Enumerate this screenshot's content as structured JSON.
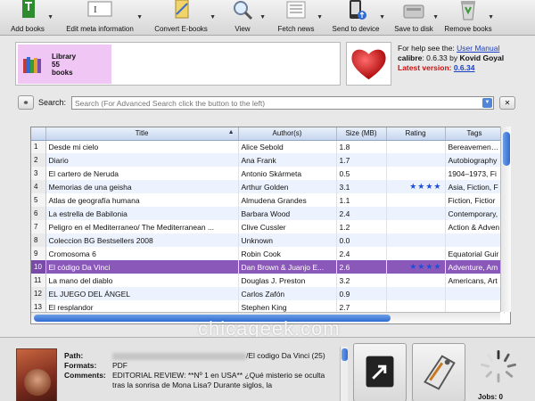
{
  "toolbar": {
    "items": [
      {
        "label": "Add books",
        "icon": "add-books-icon"
      },
      {
        "label": "Edit meta information",
        "icon": "edit-meta-icon"
      },
      {
        "label": "Convert E-books",
        "icon": "convert-icon"
      },
      {
        "label": "View",
        "icon": "magnifier-icon"
      },
      {
        "label": "Fetch news",
        "icon": "news-icon"
      },
      {
        "label": "Send to device",
        "icon": "device-icon"
      },
      {
        "label": "Save to disk",
        "icon": "disk-icon"
      },
      {
        "label": "Remove books",
        "icon": "trash-icon"
      }
    ]
  },
  "library": {
    "line1": "Library",
    "line2": "55",
    "line3": "books"
  },
  "info": {
    "help_prefix": "For help see the:",
    "help_link": "User Manual",
    "app": "calibre",
    "version_text": ": 0.6.33 by",
    "author": "Kovid Goyal",
    "latest_label": "Latest version:",
    "latest_value": "0.6.34"
  },
  "search": {
    "label": "Search:",
    "placeholder": "Search (For Advanced Search click the button to the left)"
  },
  "table": {
    "columns": {
      "title": "Title",
      "author": "Author(s)",
      "size": "Size (MB)",
      "rating": "Rating",
      "tags": "Tags"
    },
    "rows": [
      {
        "n": "1",
        "title": "Desde mi cielo",
        "author": "Alice Sebold",
        "size": "1.8",
        "rating": "",
        "tags": "Bereavement, C"
      },
      {
        "n": "2",
        "title": "Diario",
        "author": "Ana Frank",
        "size": "1.7",
        "rating": "",
        "tags": "Autobiography"
      },
      {
        "n": "3",
        "title": "El cartero de Neruda",
        "author": "Antonio Skármeta",
        "size": "0.5",
        "rating": "",
        "tags": "1904–1973, Fi"
      },
      {
        "n": "4",
        "title": "Memorias de una geisha",
        "author": "Arthur Golden",
        "size": "3.1",
        "rating": "★★★★",
        "tags": "Asia, Fiction, F"
      },
      {
        "n": "5",
        "title": "Atlas de geografía humana",
        "author": "Almudena Grandes",
        "size": "1.1",
        "rating": "",
        "tags": "Fiction, Fictior"
      },
      {
        "n": "6",
        "title": "La estrella de Babilonia",
        "author": "Barbara Wood",
        "size": "2.4",
        "rating": "",
        "tags": "Contemporary,"
      },
      {
        "n": "7",
        "title": "Peligro en el Mediterraneo/ The Mediterranean ...",
        "author": "Clive Cussler",
        "size": "1.2",
        "rating": "",
        "tags": "Action & Adven"
      },
      {
        "n": "8",
        "title": "Coleccion BG Bestsellers 2008",
        "author": "Unknown",
        "size": "0.0",
        "rating": "",
        "tags": ""
      },
      {
        "n": "9",
        "title": "Cromosoma 6",
        "author": "Robin Cook",
        "size": "2.4",
        "rating": "",
        "tags": "Equatorial Guir"
      },
      {
        "n": "10",
        "title": "El código Da Vinci",
        "author": "Dan Brown & Juanjo E...",
        "size": "2.6",
        "rating": "★★★★",
        "tags": "Adventure, Am"
      },
      {
        "n": "11",
        "title": "La mano del diablo",
        "author": "Douglas J. Preston",
        "size": "3.2",
        "rating": "",
        "tags": "Americans, Art"
      },
      {
        "n": "12",
        "title": "EL JUEGO DEL ÁNGEL",
        "author": "Carlos Zafón",
        "size": "0.9",
        "rating": "",
        "tags": ""
      },
      {
        "n": "13",
        "title": "El resplandor",
        "author": "Stephen King",
        "size": "2.7",
        "rating": "",
        "tags": ""
      }
    ]
  },
  "details": {
    "path_label": "Path:",
    "path_value": "/El codigo Da Vinci (25)",
    "formats_label": "Formats:",
    "formats_value": "PDF",
    "comments_label": "Comments:",
    "comments_value": "EDITORIAL REVIEW: **Nº 1 en USA** ¿Qué misterio se oculta tras la sonrisa de Mona Lisa? Durante siglos, la"
  },
  "jobs": {
    "label": "Jobs: 0"
  },
  "watermark": "chicageek.com"
}
